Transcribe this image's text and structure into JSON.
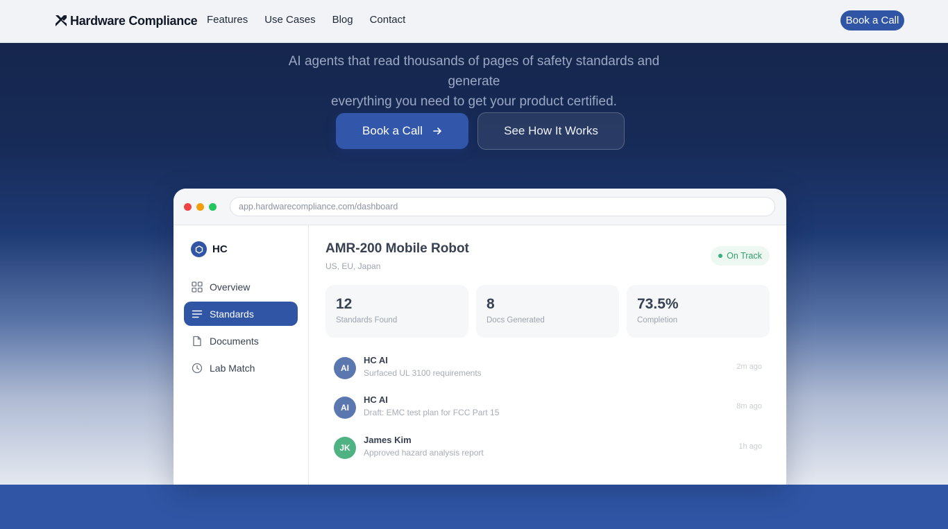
{
  "nav": {
    "brand": "Hardware Compliance",
    "links": [
      "Features",
      "Use Cases",
      "Blog",
      "Contact"
    ],
    "cta": "Book a Call"
  },
  "hero": {
    "subtitle_line1": "AI agents that read thousands of pages of safety standards and generate",
    "subtitle_line2": "everything you need to get your product certified.",
    "primary_button": "Book a Call",
    "secondary_button": "See How It Works"
  },
  "browser": {
    "url": "app.hardwarecompliance.com/dashboard",
    "traffic_colors": [
      "#ef4444",
      "#f59e0b",
      "#22c55e"
    ]
  },
  "sidebar": {
    "brand": "HC",
    "items": [
      {
        "label": "Overview",
        "icon": "grid-icon",
        "active": false
      },
      {
        "label": "Standards",
        "icon": "list-icon",
        "active": true
      },
      {
        "label": "Documents",
        "icon": "document-icon",
        "active": false
      },
      {
        "label": "Lab Match",
        "icon": "clock-icon",
        "active": false
      }
    ]
  },
  "project": {
    "title": "AMR-200 Mobile Robot",
    "regions": "US, EU, Japan",
    "status": "On Track"
  },
  "stats": [
    {
      "value": "12",
      "label": "Standards Found"
    },
    {
      "value": "8",
      "label": "Docs Generated"
    },
    {
      "value": "73.5%",
      "label": "Completion"
    }
  ],
  "activity": [
    {
      "initials": "AI",
      "name": "HC AI",
      "desc": "Surfaced UL 3100 requirements",
      "time": "2m ago",
      "color": "#5b77b0"
    },
    {
      "initials": "AI",
      "name": "HC AI",
      "desc": "Draft: EMC test plan for FCC Part 15",
      "time": "8m ago",
      "color": "#5b77b0"
    },
    {
      "initials": "JK",
      "name": "James Kim",
      "desc": "Approved hazard analysis report",
      "time": "1h ago",
      "color": "#4fb283"
    }
  ],
  "colors": {
    "accent": "#2f55a4",
    "success": "#34b27b"
  }
}
